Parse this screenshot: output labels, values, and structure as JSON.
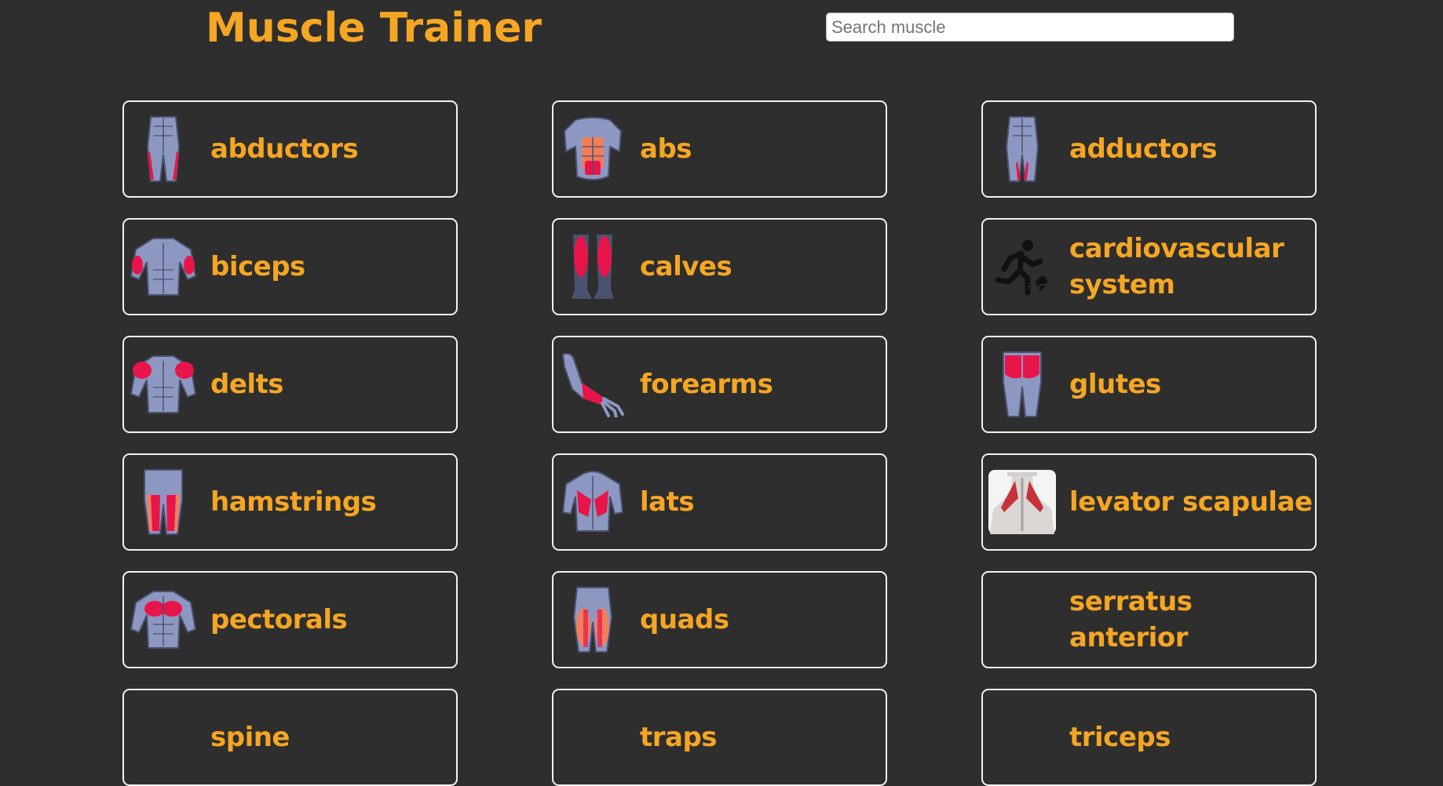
{
  "header": {
    "title": "Muscle Trainer",
    "search_placeholder": "Search muscle",
    "search_value": ""
  },
  "colors": {
    "background": "#2e2e2e",
    "accent": "#f5a623",
    "card_border": "#f2f2f2",
    "muscle_body": "#8d98c2",
    "muscle_highlight": "#e8154b",
    "muscle_secondary": "#f07f5c"
  },
  "muscles": [
    {
      "label": "abductors",
      "icon": "abductors-icon"
    },
    {
      "label": "abs",
      "icon": "abs-icon"
    },
    {
      "label": "adductors",
      "icon": "adductors-icon"
    },
    {
      "label": "biceps",
      "icon": "biceps-icon"
    },
    {
      "label": "calves",
      "icon": "calves-icon"
    },
    {
      "label": "cardiovascular system",
      "icon": "cardio-runner-icon"
    },
    {
      "label": "delts",
      "icon": "delts-icon"
    },
    {
      "label": "forearms",
      "icon": "forearms-icon"
    },
    {
      "label": "glutes",
      "icon": "glutes-icon"
    },
    {
      "label": "hamstrings",
      "icon": "hamstrings-icon"
    },
    {
      "label": "lats",
      "icon": "lats-icon"
    },
    {
      "label": "levator scapulae",
      "icon": "levator-scapulae-photo"
    },
    {
      "label": "pectorals",
      "icon": "pectorals-icon"
    },
    {
      "label": "quads",
      "icon": "quads-icon"
    },
    {
      "label": "serratus anterior",
      "icon": ""
    },
    {
      "label": "spine",
      "icon": ""
    },
    {
      "label": "traps",
      "icon": ""
    },
    {
      "label": "triceps",
      "icon": ""
    }
  ]
}
